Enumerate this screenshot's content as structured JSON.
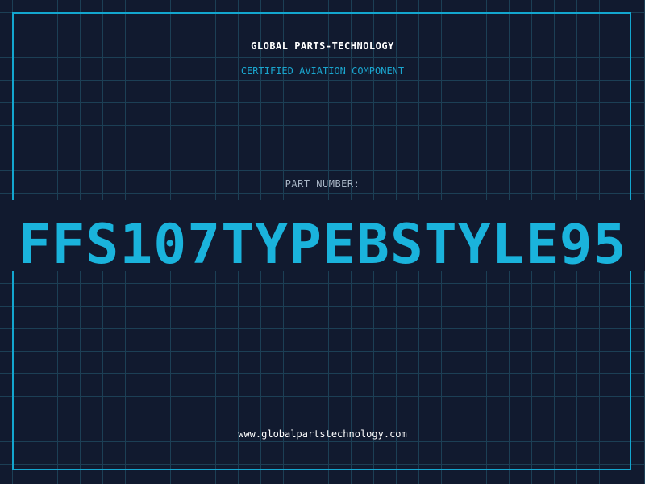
{
  "header": {
    "title": "GLOBAL PARTS-TECHNOLOGY",
    "subtitle": "CERTIFIED AVIATION COMPONENT"
  },
  "part": {
    "label": "PART NUMBER:",
    "number": "FFS107TYPEBSTYLE95"
  },
  "footer": {
    "url": "www.globalpartstechnology.com"
  },
  "colors": {
    "background": "#111a2f",
    "grid": "#1c3f55",
    "accent": "#1ab3dc",
    "frame": "#13a6cf"
  }
}
